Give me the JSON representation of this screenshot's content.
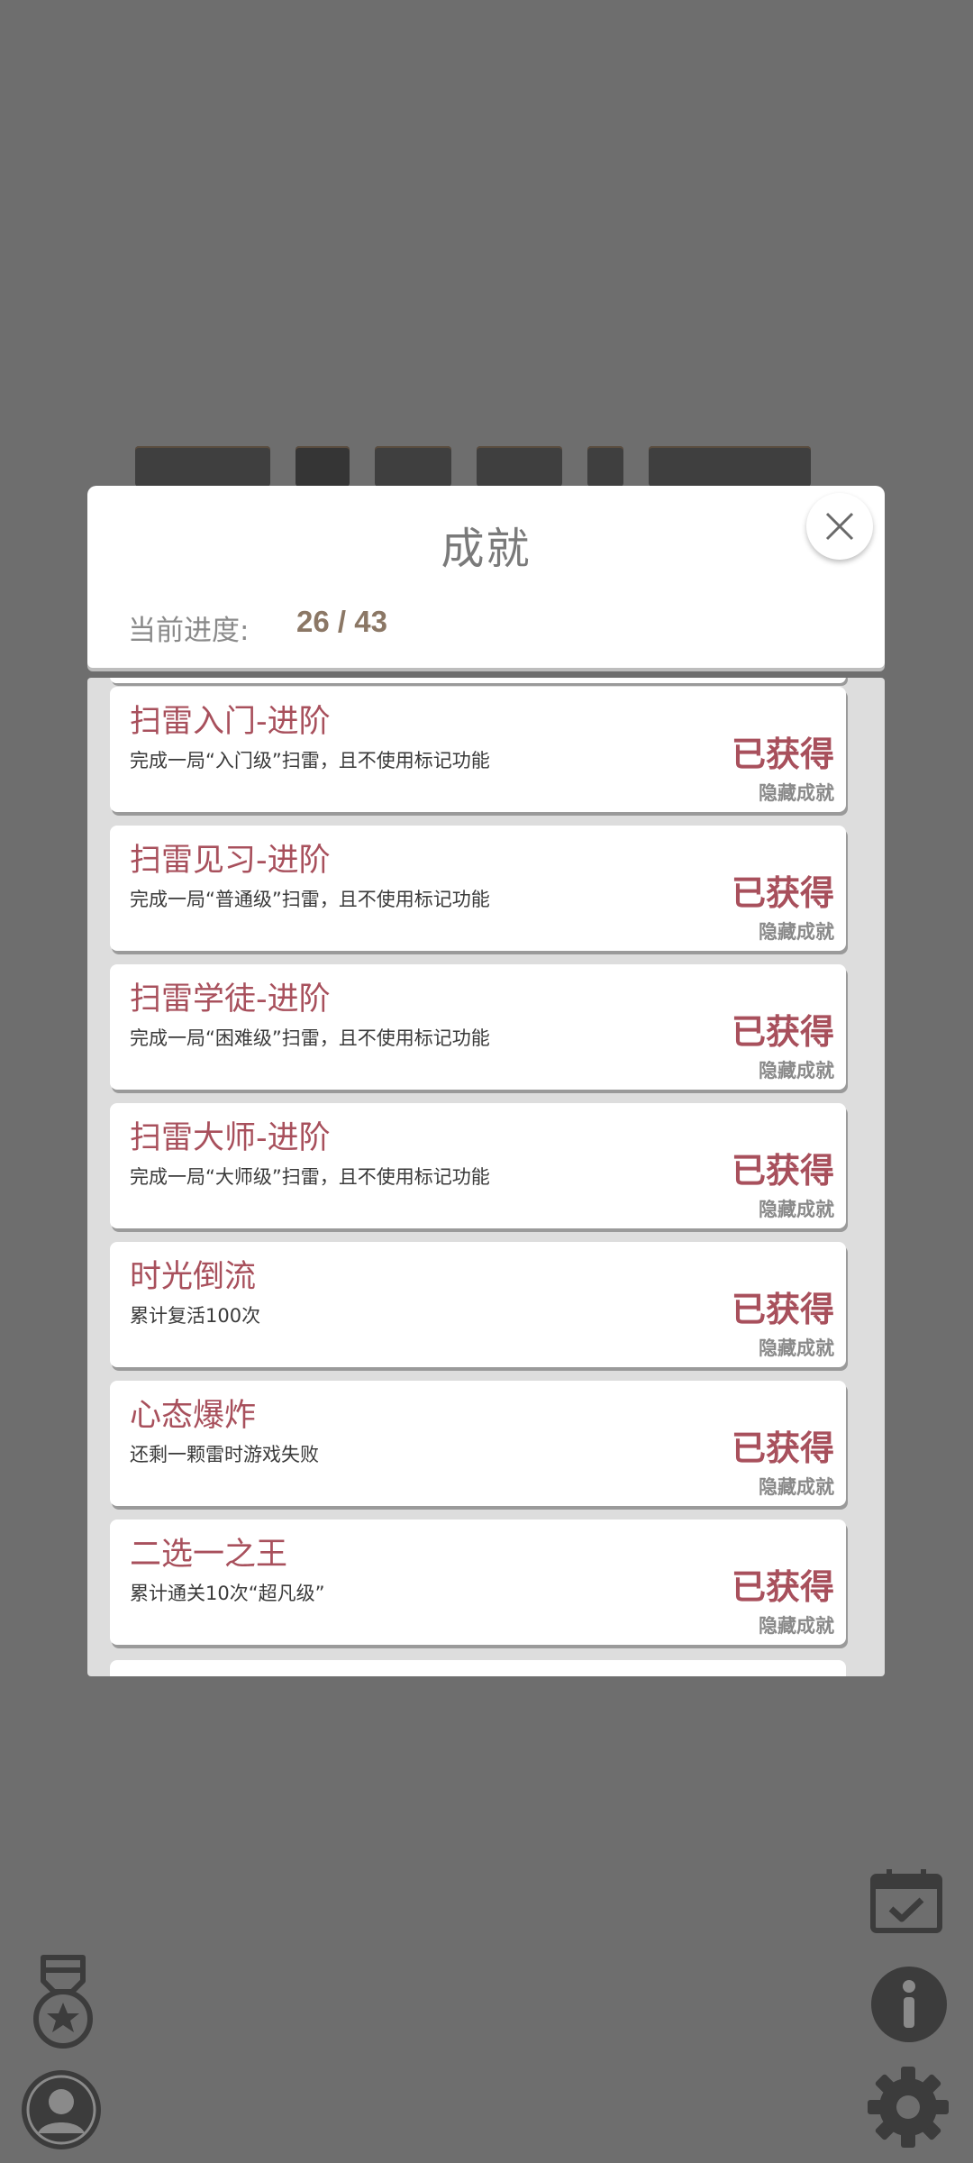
{
  "dialog": {
    "title": "成就",
    "progress_label": "当前进度:",
    "progress_value": "26 / 43"
  },
  "achievements": [
    {
      "title": "扫雷入门-进阶",
      "desc": "完成一局“入门级”扫雷，且不使用标记功能",
      "status": "已获得",
      "sub": "隐藏成就"
    },
    {
      "title": "扫雷见习-进阶",
      "desc": "完成一局“普通级”扫雷，且不使用标记功能",
      "status": "已获得",
      "sub": "隐藏成就"
    },
    {
      "title": "扫雷学徒-进阶",
      "desc": "完成一局“困难级”扫雷，且不使用标记功能",
      "status": "已获得",
      "sub": "隐藏成就"
    },
    {
      "title": "扫雷大师-进阶",
      "desc": "完成一局“大师级”扫雷，且不使用标记功能",
      "status": "已获得",
      "sub": "隐藏成就"
    },
    {
      "title": "时光倒流",
      "desc": "累计复活100次",
      "status": "已获得",
      "sub": "隐藏成就"
    },
    {
      "title": "心态爆炸",
      "desc": "还剩一颗雷时游戏失败",
      "status": "已获得",
      "sub": "隐藏成就"
    },
    {
      "title": "二选一之王",
      "desc": "累计通关10次“超凡级”",
      "status": "已获得",
      "sub": "隐藏成就"
    }
  ],
  "icons": {
    "close": "close-icon",
    "medal": "medal-icon",
    "profile": "profile-icon",
    "calendar": "calendar-check-icon",
    "info": "info-icon",
    "settings": "gear-icon"
  },
  "colors": {
    "accent": "#a8505c",
    "overlay_bg": "#6e6e6e",
    "progress": "#8b7765"
  }
}
